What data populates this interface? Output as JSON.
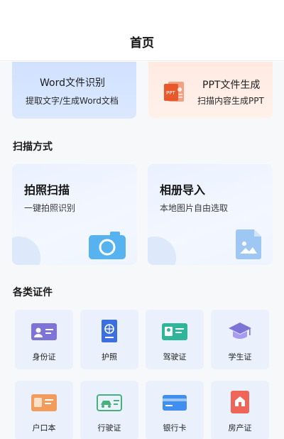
{
  "header": {
    "title": "首页"
  },
  "features": [
    {
      "title": "Word文件识别",
      "subtitle": "提取文字/生成Word文档",
      "icon": "word-icon"
    },
    {
      "title": "PPT文件生成",
      "subtitle": "扫描内容生成PPT",
      "icon": "ppt-icon",
      "icon_text": "PPT"
    }
  ],
  "scan_section": {
    "title": "扫描方式",
    "items": [
      {
        "title": "拍照扫描",
        "subtitle": "一键拍照识别",
        "icon": "camera-icon"
      },
      {
        "title": "相册导入",
        "subtitle": "本地图片自由选取",
        "icon": "image-file-icon"
      }
    ]
  },
  "cert_section": {
    "title": "各类证件",
    "items": [
      {
        "label": "身份证",
        "icon": "id-card-icon"
      },
      {
        "label": "护照",
        "icon": "passport-icon"
      },
      {
        "label": "驾驶证",
        "icon": "driver-license-icon"
      },
      {
        "label": "学生证",
        "icon": "graduation-cap-icon"
      },
      {
        "label": "户口本",
        "icon": "household-register-icon"
      },
      {
        "label": "行驶证",
        "icon": "vehicle-license-icon"
      },
      {
        "label": "银行卡",
        "icon": "bank-card-icon"
      },
      {
        "label": "房产证",
        "icon": "property-certificate-icon"
      }
    ]
  },
  "colors": {
    "card_bg": "#eaf1fd",
    "camera_blue": "#57b3f0",
    "ppt_orange": "#e8582b",
    "id_purple": "#7e73d6",
    "passport_blue": "#3b6fe0",
    "license_teal": "#2fb59a",
    "bank_blue": "#3f8ef0",
    "property_red": "#ef6659",
    "household_orange": "#f29b5b",
    "vehicle_green": "#46b27a"
  }
}
